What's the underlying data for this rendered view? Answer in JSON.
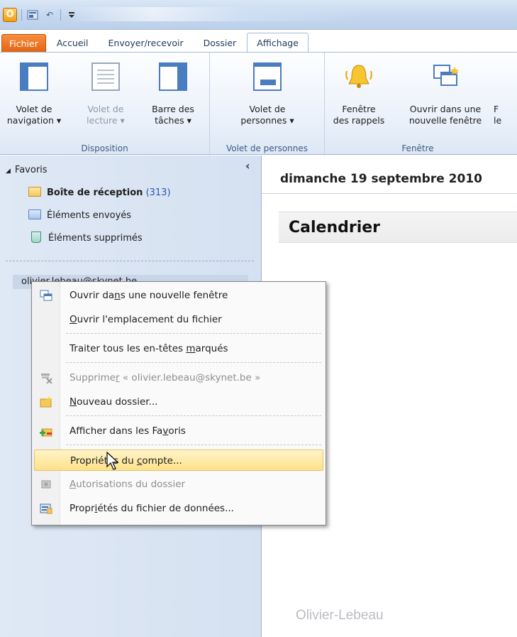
{
  "titlebar": {
    "app_icon_letter": "O",
    "undo_glyph": "↶"
  },
  "tabs": [
    "Fichier",
    "Accueil",
    "Envoyer/recevoir",
    "Dossier",
    "Affichage"
  ],
  "ribbon": {
    "groups": [
      {
        "label": "Disposition",
        "buttons": [
          {
            "line1": "Volet de",
            "line2": "navigation ▾"
          },
          {
            "line1": "Volet de",
            "line2": "lecture ▾"
          },
          {
            "line1": "Barre des",
            "line2": "tâches ▾"
          }
        ]
      },
      {
        "label": "Volet de personnes",
        "buttons": [
          {
            "line1": "Volet de",
            "line2": "personnes ▾"
          }
        ]
      },
      {
        "label": "Fenêtre",
        "buttons": [
          {
            "line1": "Fenêtre",
            "line2": "des rappels"
          },
          {
            "line1": "Ouvrir dans une",
            "line2": "nouvelle fenêtre"
          },
          {
            "line1": "F",
            "line2": "le"
          }
        ]
      }
    ]
  },
  "nav": {
    "favorites_label": "Favoris",
    "collapse_glyph": "‹",
    "items": [
      {
        "label": "Boîte de réception",
        "count": "(313)"
      },
      {
        "label": "Éléments envoyés"
      },
      {
        "label": "Éléments supprimés"
      }
    ],
    "account_label": "olivier.lebeau@skynet.be"
  },
  "calendar": {
    "date": "dimanche 19 septembre 2010",
    "title": "Calendrier",
    "watermark": "Olivier-Lebeau"
  },
  "context_menu": {
    "items": [
      {
        "pre": "Ouvrir da",
        "u": "n",
        "post": "s une nouvelle fenêtre"
      },
      {
        "pre": "",
        "u": "O",
        "post": "uvrir l'emplacement du fichier"
      },
      {
        "pre": "Traiter tous les en-têtes ",
        "u": "m",
        "post": "arqués"
      },
      {
        "pre": "Supprime",
        "u": "r",
        "post": " « olivier.lebeau@skynet.be »"
      },
      {
        "pre": "",
        "u": "N",
        "post": "ouveau dossier..."
      },
      {
        "pre": "Afficher dans les Fa",
        "u": "v",
        "post": "oris"
      },
      {
        "pre": "Propriétés du ",
        "u": "c",
        "post": "ompte..."
      },
      {
        "pre": "",
        "u": "A",
        "post": "utorisations du dossier"
      },
      {
        "pre": "Propr",
        "u": "i",
        "post": "étés du fichier de données..."
      }
    ]
  },
  "colors": {
    "file_tab": "#e06312",
    "highlight": "#fde189",
    "accent": "#4a7cc0"
  }
}
